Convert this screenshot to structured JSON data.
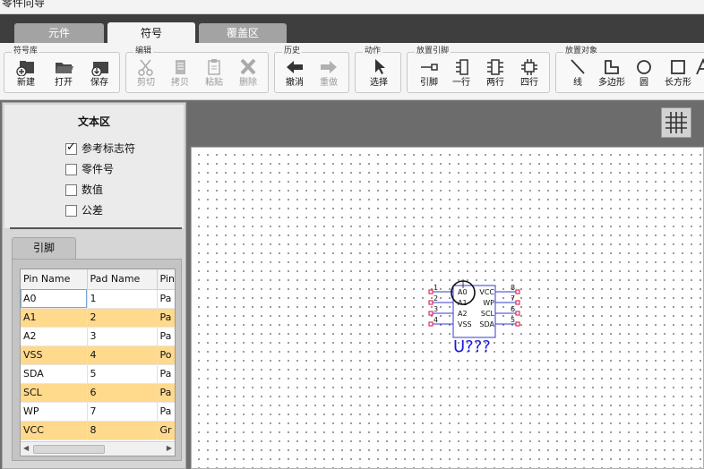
{
  "window": {
    "title": "零件向导"
  },
  "tabs": [
    {
      "label": "元件"
    },
    {
      "label": "符号"
    },
    {
      "label": "覆盖区"
    }
  ],
  "ribbon": {
    "groups": [
      {
        "title": "符号库",
        "buttons": [
          "新建",
          "打开",
          "保存"
        ]
      },
      {
        "title": "编辑",
        "buttons": [
          "剪切",
          "拷贝",
          "粘贴",
          "删除"
        ]
      },
      {
        "title": "历史",
        "buttons": [
          "撤消",
          "重做"
        ]
      },
      {
        "title": "动作",
        "buttons": [
          "选择"
        ]
      },
      {
        "title": "放置引脚",
        "buttons": [
          "引脚",
          "一行",
          "两行",
          "四行"
        ]
      },
      {
        "title": "放置对象",
        "buttons": [
          "线",
          "多边形",
          "圆",
          "长方形"
        ]
      }
    ]
  },
  "text_area": {
    "title": "文本区",
    "options": [
      {
        "label": "参考标志符",
        "checked": true
      },
      {
        "label": "零件号",
        "checked": false
      },
      {
        "label": "数值",
        "checked": false
      },
      {
        "label": "公差",
        "checked": false
      }
    ]
  },
  "pins_tab": {
    "label": "引脚"
  },
  "pin_table": {
    "columns": [
      "Pin Name",
      "Pad Name",
      "Pin"
    ],
    "rows": [
      [
        "A0",
        "1",
        "Pa"
      ],
      [
        "A1",
        "2",
        "Pa"
      ],
      [
        "A2",
        "3",
        "Pa"
      ],
      [
        "VSS",
        "4",
        "Po"
      ],
      [
        "SDA",
        "5",
        "Pa"
      ],
      [
        "SCL",
        "6",
        "Pa"
      ],
      [
        "WP",
        "7",
        "Pa"
      ],
      [
        "VCC",
        "8",
        "Gr"
      ]
    ]
  },
  "symbol": {
    "ref": "U???",
    "left_pins": [
      {
        "num": "1",
        "name": "A0"
      },
      {
        "num": "2",
        "name": "A1"
      },
      {
        "num": "3",
        "name": "A2"
      },
      {
        "num": "4",
        "name": "VSS"
      }
    ],
    "right_pins": [
      {
        "num": "8",
        "name": "VCC"
      },
      {
        "num": "7",
        "name": "WP"
      },
      {
        "num": "6",
        "name": "SCL"
      },
      {
        "num": "5",
        "name": "SDA"
      }
    ]
  },
  "colors": {
    "ref_label": "#1a1adf",
    "pin_row_alt": "#ffd98c",
    "pin_line": "#3a3ad0",
    "pin_end": "#e0305a"
  }
}
